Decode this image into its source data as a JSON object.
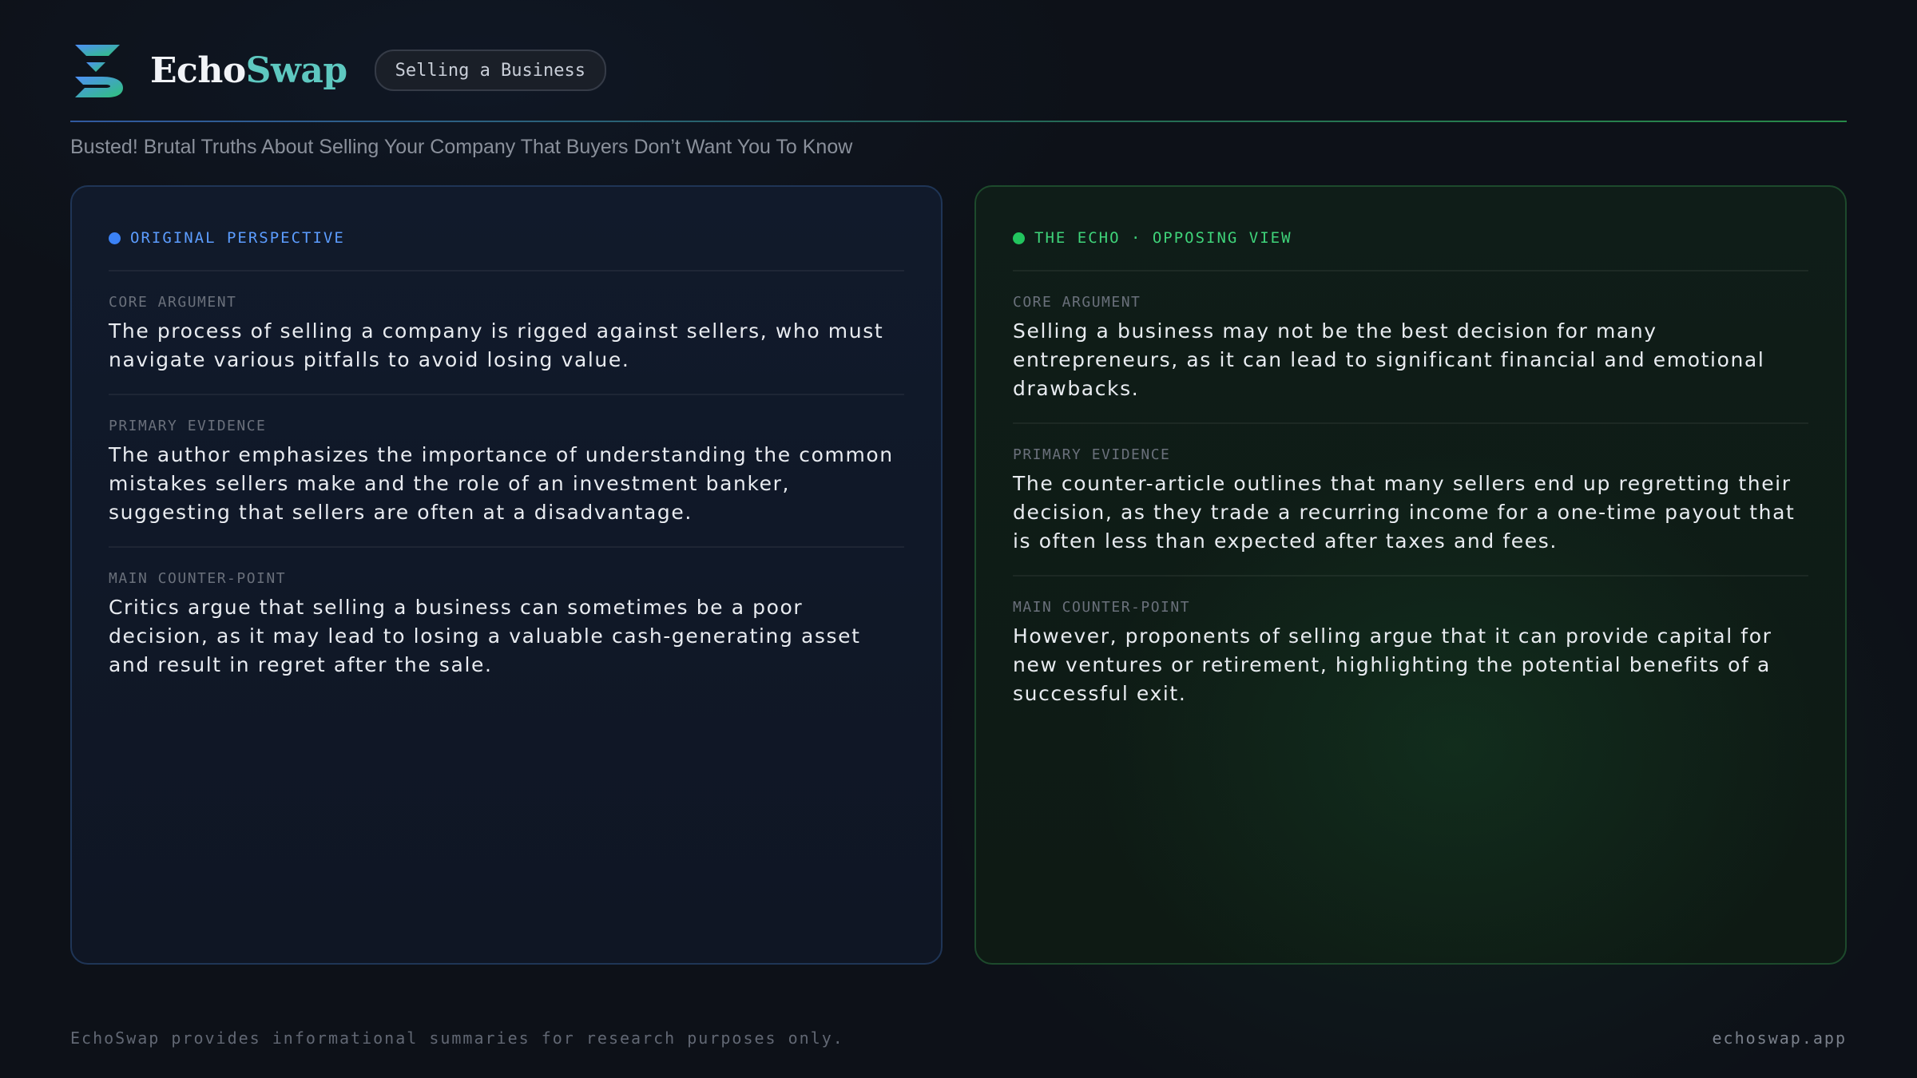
{
  "header": {
    "brand_first": "Echo",
    "brand_second": "Swap",
    "topic": "Selling a Business"
  },
  "headline": "Busted! Brutal Truths About Selling Your Company That Buyers Don’t Want You To Know",
  "panels": {
    "original": {
      "label": "ORIGINAL PERSPECTIVE",
      "sections": [
        {
          "title": "CORE ARGUMENT",
          "text": "The process of selling a company is rigged against sellers, who must navigate various pitfalls to avoid losing value."
        },
        {
          "title": "PRIMARY EVIDENCE",
          "text": "The author emphasizes the importance of understanding the common mistakes sellers make and the role of an investment banker, suggesting that sellers are often at a disadvantage."
        },
        {
          "title": "MAIN COUNTER-POINT",
          "text": "Critics argue that selling a business can sometimes be a poor decision, as it may lead to losing a valuable cash-generating asset and result in regret after the sale."
        }
      ]
    },
    "echo": {
      "label": "THE ECHO · OPPOSING VIEW",
      "sections": [
        {
          "title": "CORE ARGUMENT",
          "text": "Selling a business may not be the best decision for many entrepreneurs, as it can lead to significant financial and emotional drawbacks."
        },
        {
          "title": "PRIMARY EVIDENCE",
          "text": "The counter-article outlines that many sellers end up regretting their decision, as they trade a recurring income for a one-time payout that is often less than expected after taxes and fees."
        },
        {
          "title": "MAIN COUNTER-POINT",
          "text": "However, proponents of selling argue that it can provide capital for new ventures or retirement, highlighting the potential benefits of a successful exit."
        }
      ]
    }
  },
  "footer": {
    "disclaimer": "EchoSwap provides informational summaries for research purposes only.",
    "site": "echoswap.app"
  },
  "colors": {
    "original_accent": "#3b82f6",
    "echo_accent": "#22c55e",
    "brand_swap": "#5ec8c0"
  }
}
